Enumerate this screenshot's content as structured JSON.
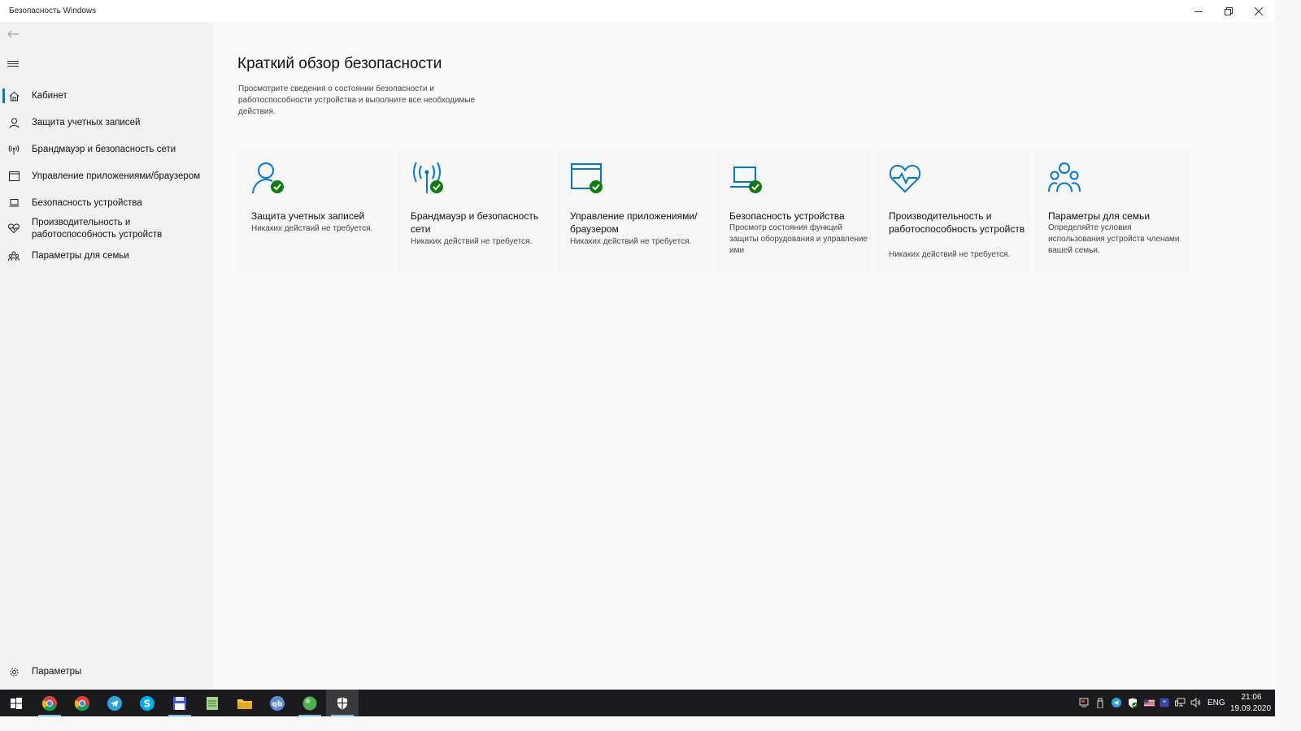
{
  "window": {
    "title": "Безопасность Windows",
    "minimize_icon": "minimize-icon",
    "restore_icon": "restore-icon",
    "close_icon": "close-icon"
  },
  "sidebar": {
    "items": [
      {
        "label": "Кабинет",
        "icon": "home-icon",
        "selected": true
      },
      {
        "label": "Защита учетных записей",
        "icon": "person-icon"
      },
      {
        "label": "Брандмауэр и безопасность сети",
        "icon": "antenna-icon"
      },
      {
        "label": "Управление приложениями/браузером",
        "icon": "browser-window-icon"
      },
      {
        "label": "Безопасность устройства",
        "icon": "laptop-icon"
      },
      {
        "label": "Производительность и работоспособность устройств",
        "icon": "heart-pulse-icon"
      },
      {
        "label": "Параметры для семьи",
        "icon": "family-icon"
      }
    ],
    "settings_label": "Параметры"
  },
  "main": {
    "title": "Краткий обзор безопасности",
    "description": "Просмотрите сведения о состоянии безопасности и работоспособности устройства и выполните все необходимые действия.",
    "cards": [
      {
        "title": "Защита учетных записей",
        "status": "Никаких действий не требуется.",
        "icon": "person-check-icon"
      },
      {
        "title": "Брандмауэр и безопасность сети",
        "status": "Никаких действий не требуется.",
        "icon": "antenna-check-icon"
      },
      {
        "title": "Управление приложениями/браузером",
        "status": "Никаких действий не требуется.",
        "icon": "browser-check-icon"
      },
      {
        "title": "Безопасность устройства",
        "status": "Просмотр состояния функций защиты оборудования и управление ими",
        "icon": "laptop-check-icon"
      },
      {
        "title": "Производительность и работоспособность устройств",
        "status": "Никаких действий не требуется.",
        "icon": "heart-pulse-icon"
      },
      {
        "title": "Параметры для семьи",
        "status": "Определяйте условия использования устройств членами вашей семьи.",
        "icon": "family-icon"
      }
    ]
  },
  "taskbar": {
    "lang": "ENG",
    "time": "21:06",
    "date": "19.09.2020"
  },
  "colors": {
    "accent": "#0078d4",
    "ok_green": "#107c10"
  }
}
